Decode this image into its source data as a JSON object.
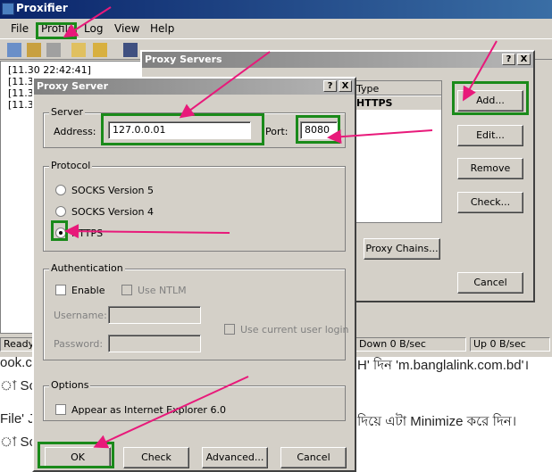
{
  "main_window": {
    "title": "Proxifier",
    "menu": [
      "File",
      "Profile",
      "Log",
      "View",
      "Help"
    ],
    "log_lines": [
      "[11.30 22:42:41]",
      "[11.30",
      "[11.30",
      "[11.30"
    ],
    "status": {
      "ready": "Ready",
      "down": "Down 0 B/sec",
      "up": "Up 0 B/sec"
    }
  },
  "background_text": [
    "ook.c",
    "H' দিন 'm.banglalink.com.bd'।",
    "া Scr",
    "File' J",
    "দিয়ে এটা Minimize করে দিন।",
    "া Scr"
  ],
  "proxy_servers": {
    "title": "Proxy Servers",
    "title_buttons": [
      "?",
      "X"
    ],
    "column_type": "Type",
    "row_type": "HTTPS",
    "buttons": {
      "add": "Add...",
      "edit": "Edit...",
      "remove": "Remove",
      "check": "Check...",
      "chains": "Proxy Chains...",
      "cancel": "Cancel"
    }
  },
  "proxy_server": {
    "title": "Proxy Server",
    "title_buttons": [
      "?",
      "X"
    ],
    "server": {
      "group": "Server",
      "address_label": "Address:",
      "address": "127.0.0.01",
      "port_label": "Port:",
      "port": "8080"
    },
    "protocol": {
      "group": "Protocol",
      "socks5": "SOCKS Version 5",
      "socks4": "SOCKS Version 4",
      "https": "HTTPS",
      "selected": "HTTPS"
    },
    "auth": {
      "group": "Authentication",
      "enable": "Enable",
      "use_ntlm": "Use NTLM",
      "username_label": "Username:",
      "password_label": "Password:",
      "use_current": "Use current user login"
    },
    "options": {
      "group": "Options",
      "ie6": "Appear as Internet Explorer 6.0"
    },
    "buttons": {
      "ok": "OK",
      "check": "Check",
      "advanced": "Advanced...",
      "cancel": "Cancel"
    }
  },
  "annotation_colors": {
    "box": "#1a8a1a",
    "arrow": "#e8197a"
  }
}
